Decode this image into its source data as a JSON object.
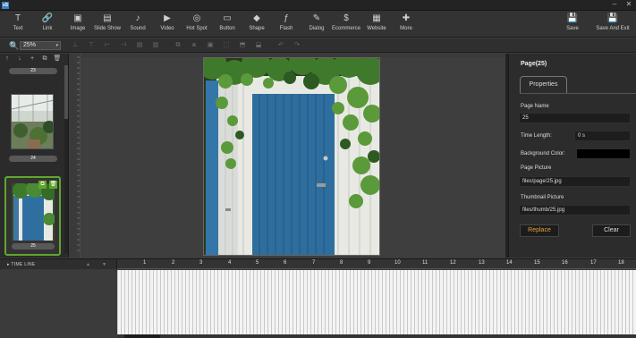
{
  "window": {
    "logo": "vS",
    "minimize": "–",
    "close": "✕"
  },
  "toolbar": {
    "items": [
      {
        "label": "Text",
        "icon": "T"
      },
      {
        "label": "Link",
        "icon": "🔗"
      },
      {
        "label": "Image",
        "icon": "▣"
      },
      {
        "label": "Slide Show",
        "icon": "▤"
      },
      {
        "label": "Sound",
        "icon": "♪"
      },
      {
        "label": "Video",
        "icon": "▶"
      },
      {
        "label": "Hot Spot",
        "icon": "◎"
      },
      {
        "label": "Button",
        "icon": "▭"
      },
      {
        "label": "Shape",
        "icon": "◆"
      },
      {
        "label": "Flash",
        "icon": "ƒ"
      },
      {
        "label": "Dialog",
        "icon": "✎"
      },
      {
        "label": "Ecommerce",
        "icon": "$"
      },
      {
        "label": "Website",
        "icon": "▦"
      },
      {
        "label": "More",
        "icon": "✚"
      }
    ],
    "save": {
      "label": "Save",
      "icon": "💾"
    },
    "save_exit": {
      "label": "Save And Exit",
      "icon": "💾"
    }
  },
  "zoom": {
    "icon": "🔍",
    "value": "25%",
    "caret": "▾"
  },
  "secondary_tools": [
    "⊥",
    "⊤",
    "⊢",
    "⊣",
    "▤",
    "▥",
    "⧉",
    "⧈",
    "▣",
    "⬚",
    "⬒",
    "⬓",
    "↶",
    "↷"
  ],
  "pages_panel": {
    "tools": [
      "↑",
      "↓",
      "+",
      "⧉",
      "🗑"
    ],
    "pages": [
      {
        "label": "23"
      },
      {
        "label": "24"
      },
      {
        "label": "25",
        "selected": true
      }
    ],
    "copy_icon": "⧉",
    "delete_icon": "🗑"
  },
  "properties": {
    "title": "Page(25)",
    "tab": "Properties",
    "page_name_label": "Page Name",
    "page_name_value": "25",
    "time_length_label": "Time Length:",
    "time_length_value": "0 s",
    "background_color_label": "Background Color:",
    "background_color_value": "#000000",
    "page_picture_label": "Page Picture",
    "page_picture_value": "files/page/25.jpg",
    "thumbnail_picture_label": "Thumbnail Picture",
    "thumbnail_picture_value": "files/thumb/25.jpg",
    "replace_label": "Replace",
    "clear_label": "Clear"
  },
  "timeline": {
    "title": "▸ TIME LINE",
    "up": "▲",
    "down": "▼",
    "ticks": [
      "1",
      "2",
      "3",
      "4",
      "5",
      "6",
      "7",
      "8",
      "9",
      "10",
      "11",
      "12",
      "13",
      "14",
      "15",
      "16",
      "17",
      "18"
    ]
  },
  "colors": {
    "accent_green": "#61a62d",
    "replace_orange": "#e6a23c",
    "door_blue": "#2f6f9f"
  }
}
